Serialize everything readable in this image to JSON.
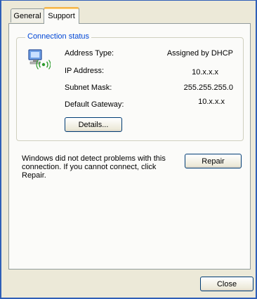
{
  "tabs": [
    {
      "label": "General",
      "active": false
    },
    {
      "label": "Support",
      "active": true
    }
  ],
  "connection_status": {
    "title": "Connection status",
    "icon": "network-connection-icon",
    "rows": [
      {
        "label": "Address Type:",
        "value": "Assigned by DHCP"
      },
      {
        "label": "IP Address:",
        "value": "10.x.x.x"
      },
      {
        "label": "Subnet Mask:",
        "value": "255.255.255.0"
      },
      {
        "label": "Default Gateway:",
        "value": "10.x.x.x"
      }
    ],
    "details_label": "Details..."
  },
  "repair": {
    "message": "Windows did not detect problems with this connection. If you cannot connect, click Repair.",
    "button_label": "Repair"
  },
  "footer": {
    "close_label": "Close"
  },
  "colors": {
    "accent_title": "#0046d5",
    "window_border": "#2f5fb8",
    "tab_highlight": "#f4b54a"
  }
}
